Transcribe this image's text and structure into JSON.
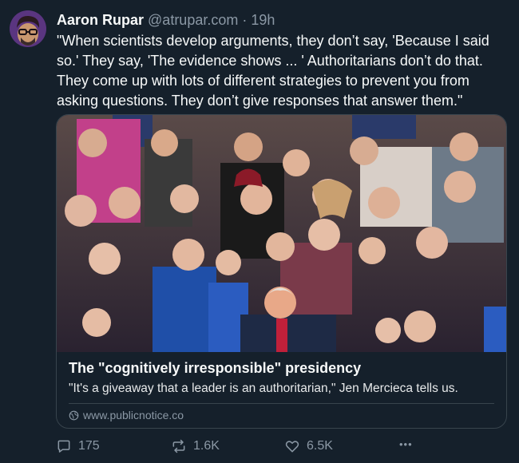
{
  "author": {
    "display_name": "Aaron Rupar",
    "handle": "@atrupar.com",
    "separator": "·",
    "timestamp": "19h"
  },
  "tweet": {
    "text": "\"When scientists develop arguments, they don’t say, 'Because I said so.' They say, 'The evidence shows ... ' Authoritarians don’t do that. They come up with lots of different strategies to prevent you from asking questions. They don’t give responses that answer them.\""
  },
  "link_card": {
    "title": "The \"cognitively irresponsible\" presidency",
    "description": "\"It's a giveaway that a leader is an authoritarian,\" Jen Mercieca tells us.",
    "domain": "www.publicnotice.co"
  },
  "actions": {
    "replies": "175",
    "reposts": "1.6K",
    "likes": "6.5K",
    "more": "•••"
  },
  "icons": [
    "reply-icon",
    "repost-icon",
    "like-icon",
    "more-icon",
    "globe-icon"
  ],
  "colors": {
    "background": "#15202b",
    "text_primary": "#f7f9f9",
    "text_secondary": "#8b98a5",
    "border": "#38444d"
  }
}
